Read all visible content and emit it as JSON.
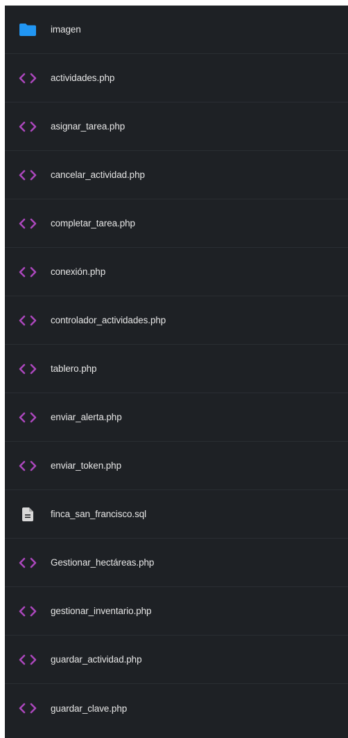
{
  "colors": {
    "panel_background": "#1e2125",
    "divider": "#2a2e33",
    "text": "#e6e6e6",
    "folder_icon": "#2196f3",
    "code_icon": "#ab47bc",
    "document_icon": "#d8d8d8"
  },
  "files": [
    {
      "name": "imagen",
      "icon": "folder-icon"
    },
    {
      "name": "actividades.php",
      "icon": "code-icon"
    },
    {
      "name": "asignar_tarea.php",
      "icon": "code-icon"
    },
    {
      "name": "cancelar_actividad.php",
      "icon": "code-icon"
    },
    {
      "name": "completar_tarea.php",
      "icon": "code-icon"
    },
    {
      "name": "conexión.php",
      "icon": "code-icon"
    },
    {
      "name": "controlador_actividades.php",
      "icon": "code-icon"
    },
    {
      "name": "tablero.php",
      "icon": "code-icon"
    },
    {
      "name": "enviar_alerta.php",
      "icon": "code-icon"
    },
    {
      "name": "enviar_token.php",
      "icon": "code-icon"
    },
    {
      "name": "finca_san_francisco.sql",
      "icon": "document-icon"
    },
    {
      "name": "Gestionar_hectáreas.php",
      "icon": "code-icon"
    },
    {
      "name": "gestionar_inventario.php",
      "icon": "code-icon"
    },
    {
      "name": "guardar_actividad.php",
      "icon": "code-icon"
    },
    {
      "name": "guardar_clave.php",
      "icon": "code-icon"
    }
  ]
}
